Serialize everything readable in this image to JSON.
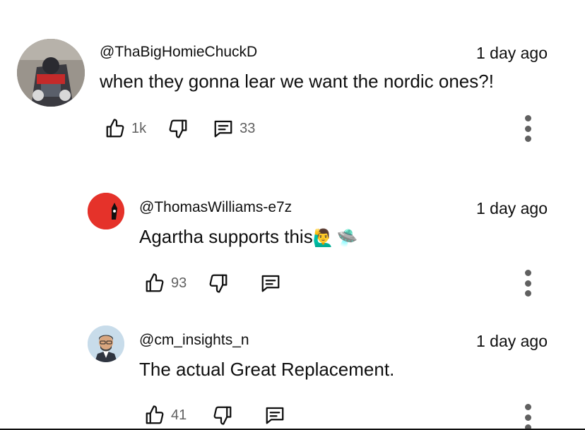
{
  "comments": [
    {
      "handle": "@ThaBigHomieChuckD",
      "time": "1 day ago",
      "text": "when they gonna lear we want the nordic ones?!",
      "likes": "1k",
      "replies": "33"
    },
    {
      "handle": "@ThomasWilliams-e7z",
      "time": "1 day ago",
      "text": "Agartha supports this",
      "emojis": [
        "🙋‍♂️",
        "🛸"
      ],
      "likes": "93"
    },
    {
      "handle": "@cm_insights_n",
      "time": "1 day ago",
      "text": "The actual Great Replacement.",
      "likes": "41"
    }
  ],
  "icons": {
    "like": "thumbs-up-icon",
    "dislike": "thumbs-down-icon",
    "reply": "comment-icon",
    "more": "more-vert-icon"
  }
}
